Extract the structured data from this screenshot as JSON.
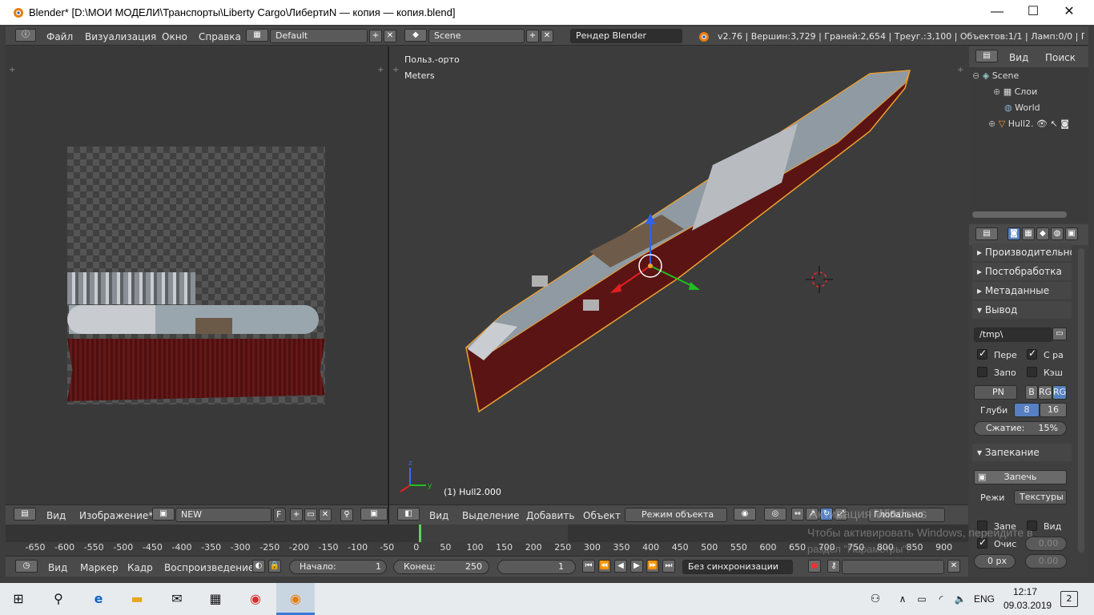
{
  "window": {
    "title": "Blender* [D:\\МОИ МОДЕЛИ\\Транспорты\\Liberty Cargo\\ЛибертиN — копия — копия.blend]"
  },
  "info_bar": {
    "menus": [
      "Файл",
      "Визуализация",
      "Окно",
      "Справка"
    ],
    "layout_field": "Default",
    "scene_field": "Scene",
    "render_engine": "Рендер Blender",
    "stats": "v2.76 | Вершин:3,729 | Граней:2,654 | Треуг.:3,100 | Объектов:1/1 | Ламп:0/0 | Пам.:67.",
    "icons": [
      "info-icon",
      "layout-icon",
      "scene-icon",
      "blender-logo-icon"
    ]
  },
  "image_editor": {
    "menus": [
      "Вид",
      "Изображение*"
    ],
    "image_name": "NEW",
    "fake_user": "F"
  },
  "viewport": {
    "view_label": "Польз.-орто",
    "units_label": "Meters",
    "object_label": "(1) Hull2.000",
    "menus": [
      "Вид",
      "Выделение",
      "Добавить",
      "Объект"
    ],
    "mode": "Режим объекта",
    "orientation": "Глобально",
    "axis_x": "x",
    "axis_y": "y",
    "axis_z": "z"
  },
  "outliner": {
    "menus": [
      "Вид",
      "Поиск"
    ],
    "items": [
      {
        "label": "Scene",
        "icon": "scene-icon"
      },
      {
        "label": "Слои",
        "icon": "render-layers-icon"
      },
      {
        "label": "World",
        "icon": "world-icon"
      },
      {
        "label": "Hull2.",
        "icon": "mesh-icon"
      }
    ]
  },
  "properties": {
    "panels": [
      "Производительно",
      "Постобработка",
      "Метаданные",
      "Вывод",
      "Запекание"
    ],
    "output_path": "/tmp\\",
    "overwrite": "Пере",
    "placeholders": "С ра",
    "file_ext": "Запо",
    "cache": "Кэш",
    "format": "PN",
    "color_modes": [
      "B",
      "RG",
      "RG"
    ],
    "depth_label": "Глуби",
    "depth_values": [
      "8",
      "16"
    ],
    "compression": "Сжатие:",
    "compression_value": "15%",
    "bake_button": "Запечь",
    "bake_mode_label": "Режи",
    "bake_mode": "Текстуры",
    "extra_left": "Запе",
    "extra_right": "Вид",
    "clear": "Очис",
    "margin_value": "0 px",
    "small_values": [
      "0.00",
      "0.00"
    ]
  },
  "timeline": {
    "menus": [
      "Вид",
      "Маркер",
      "Кадр",
      "Воспроизведение"
    ],
    "start_label": "Начало:",
    "start_value": "1",
    "end_label": "Конец:",
    "end_value": "250",
    "current_frame": "1",
    "sync": "Без синхронизации",
    "ruler": [
      "-650",
      "-600",
      "-550",
      "-500",
      "-450",
      "-400",
      "-350",
      "-300",
      "-250",
      "-200",
      "-150",
      "-100",
      "-50",
      "0",
      "50",
      "100",
      "150",
      "200",
      "250",
      "300",
      "350",
      "400",
      "450",
      "500",
      "550",
      "600",
      "650",
      "700",
      "750",
      "800",
      "850",
      "900"
    ]
  },
  "watermark": {
    "line1": "Активация Windows",
    "line2": "Чтобы активировать Windows, перейдите в",
    "line3": "раздел \"Параметры\"."
  },
  "taskbar": {
    "lang": "ENG",
    "time": "12:17",
    "date": "09.03.2019",
    "notifications": "2",
    "apps": [
      "start-icon",
      "search-icon",
      "edge-icon",
      "explorer-icon",
      "mail-icon",
      "store-icon",
      "chrome-icon",
      "blender-icon"
    ]
  },
  "colors": {
    "accent": "#5680c2",
    "selected_orange": "#f0a030",
    "hull_red": "#5a1414"
  }
}
